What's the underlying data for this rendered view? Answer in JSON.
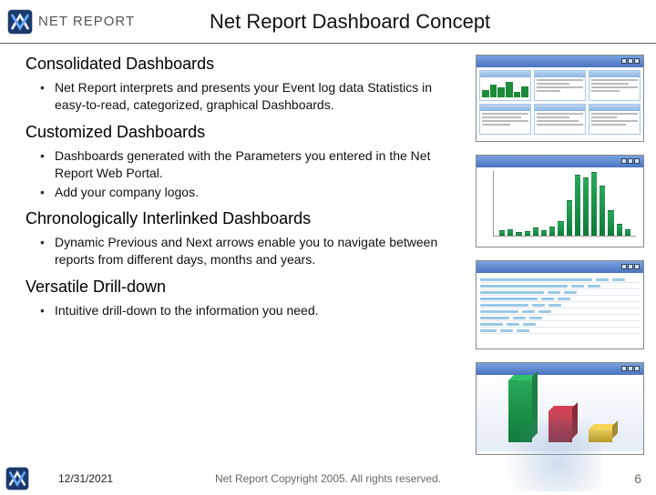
{
  "header": {
    "brand": "NET REPORT",
    "title": "Net Report Dashboard Concept"
  },
  "sections": [
    {
      "heading": "Consolidated Dashboards",
      "bullets": [
        "Net Report interprets and presents your Event log data Statistics in easy-to-read, categorized, graphical Dashboards."
      ]
    },
    {
      "heading": "Customized Dashboards",
      "bullets": [
        "Dashboards generated with the Parameters you entered in the Net Report Web Portal.",
        "Add your company logos."
      ]
    },
    {
      "heading": "Chronologically Interlinked Dashboards",
      "bullets": [
        "Dynamic Previous and Next arrows enable you to navigate between reports from different days, months and years."
      ]
    },
    {
      "heading": "Versatile Drill-down",
      "bullets": [
        "Intuitive drill-down to the information you need."
      ]
    }
  ],
  "footer": {
    "date": "12/31/2021",
    "copyright": "Net Report Copyright 2005. All rights reserved.",
    "page": "6"
  }
}
